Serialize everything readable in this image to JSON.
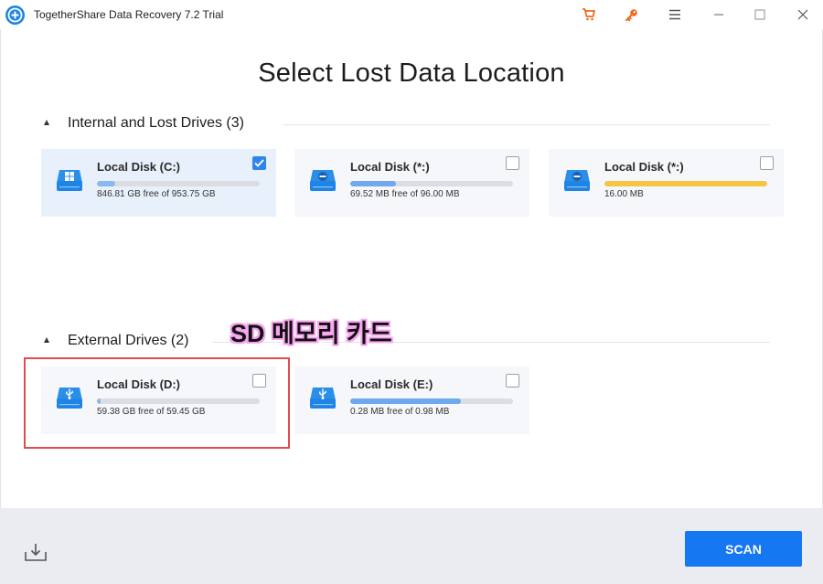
{
  "window": {
    "title": "TogetherShare Data Recovery 7.2 Trial",
    "icons": [
      "app-logo-icon",
      "cart-icon",
      "key-icon",
      "menu-icon",
      "minimize-icon",
      "maximize-icon",
      "close-icon"
    ]
  },
  "main": {
    "title": "Select Lost Data Location"
  },
  "internal": {
    "label": "Internal and Lost Drives (3)",
    "drives": [
      {
        "name": "Local Disk (C:)",
        "size_text": "846.81 GB free of 953.75 GB",
        "used_fraction": 0.11,
        "checked": true,
        "icon": "windows-drive-icon"
      },
      {
        "name": "Local Disk (*:)",
        "size_text": "69.52 MB free of 96.00 MB",
        "used_fraction": 0.28,
        "checked": false,
        "icon": "drive-icon"
      },
      {
        "name": "Local Disk (*:)",
        "size_text": "16.00 MB",
        "used_fraction": 1.0,
        "checked": false,
        "icon": "drive-icon"
      }
    ]
  },
  "external": {
    "label": "External Drives (2)",
    "drives": [
      {
        "name": "Local Disk (D:)",
        "size_text": "59.38 GB free of 59.45 GB",
        "used_fraction": 0.01,
        "checked": false,
        "icon": "usb-drive-icon"
      },
      {
        "name": "Local Disk (E:)",
        "size_text": "0.28 MB free of 0.98 MB",
        "used_fraction": 0.68,
        "checked": false,
        "icon": "usb-drive-icon"
      }
    ]
  },
  "annotation": {
    "text": "SD 메모리 카드",
    "border_color": "#e24c4c",
    "highlight_color": "#f8a4f0"
  },
  "footer": {
    "scan_label": "SCAN",
    "download_icon": "download-icon"
  },
  "colors": {
    "accent": "#1677f2",
    "check_blue": "#2f86e8",
    "drive_blue": "#1e84e6",
    "bar_full": "#f5c542",
    "bar_used": "#8ab8f0"
  }
}
